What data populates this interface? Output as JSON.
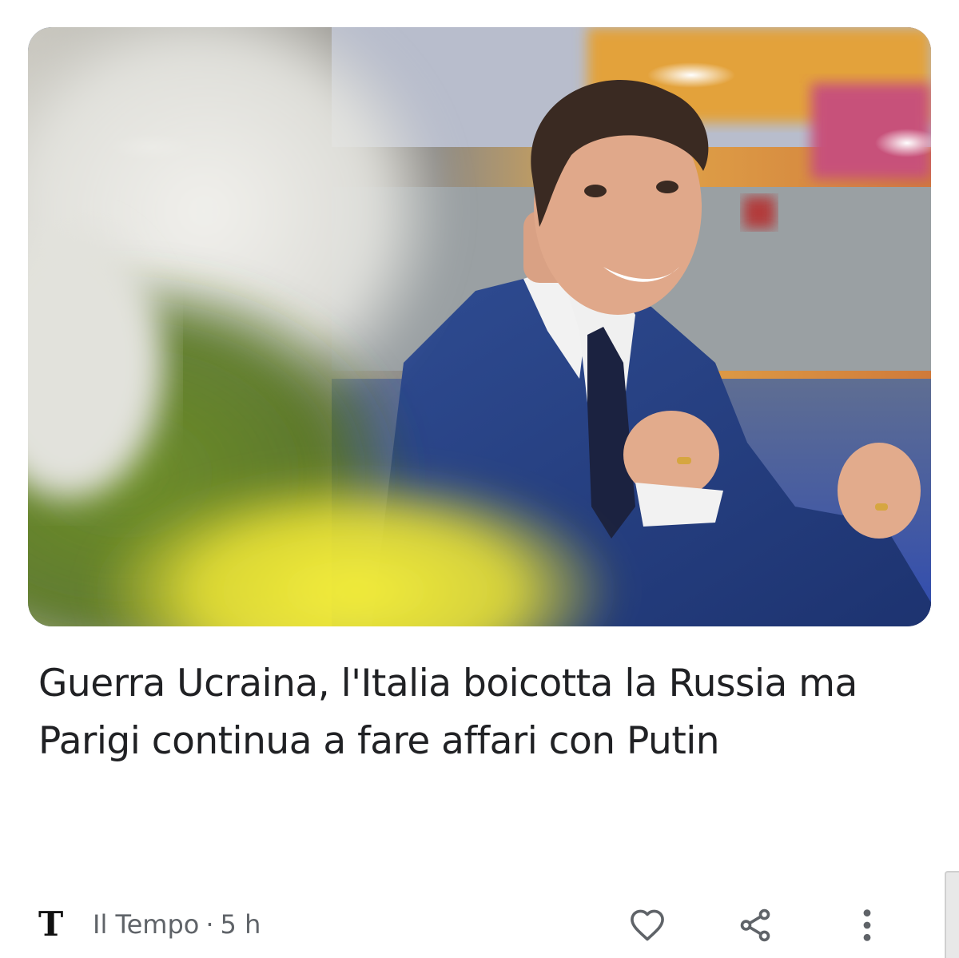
{
  "article": {
    "image_alt": "Photo",
    "headline": "Guerra Ucraina, l'Italia boicotta la Russia ma Parigi continua a fare affari con Putin"
  },
  "meta": {
    "source_logo": "T",
    "source_name": "Il Tempo",
    "separator": "·",
    "age": "5 h"
  },
  "actions": {
    "like_icon": "heart-outline-icon",
    "share_icon": "share-icon",
    "more_icon": "more-vertical-icon"
  },
  "colors": {
    "headline_text": "#202124",
    "meta_text": "#5f6368",
    "icon": "#5f6368"
  }
}
